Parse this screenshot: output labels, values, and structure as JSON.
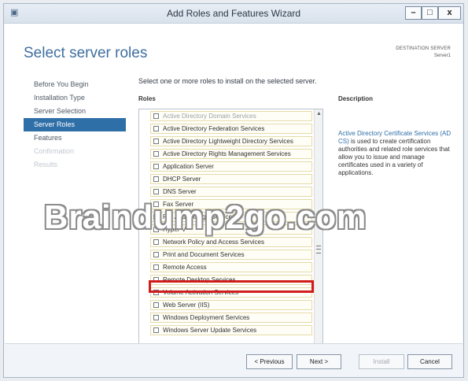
{
  "window": {
    "title": "Add Roles and Features Wizard",
    "controls": {
      "minimize": "–",
      "maximize": "□",
      "close": "x"
    }
  },
  "header": {
    "page_title": "Select server roles",
    "destination_label": "DESTINATION SERVER",
    "destination_value": "Server1"
  },
  "nav": {
    "items": [
      {
        "label": "Before You Begin",
        "state": "normal"
      },
      {
        "label": "Installation Type",
        "state": "normal"
      },
      {
        "label": "Server Selection",
        "state": "normal"
      },
      {
        "label": "Server Roles",
        "state": "active"
      },
      {
        "label": "Features",
        "state": "normal"
      },
      {
        "label": "Confirmation",
        "state": "disabled"
      },
      {
        "label": "Results",
        "state": "disabled"
      }
    ]
  },
  "main": {
    "instruction": "Select one or more roles to install on the selected server.",
    "roles_heading": "Roles",
    "roles": [
      "Active Directory Domain Services",
      "Active Directory Federation Services",
      "Active Directory Lightweight Directory Services",
      "Active Directory Rights Management Services",
      "Application Server",
      "DHCP Server",
      "DNS Server",
      "Fax Server",
      "File And Storage Services",
      "Hyper-V",
      "Network Policy and Access Services",
      "Print and Document Services",
      "Remote Access",
      "Remote Desktop Services",
      "Volume Activation Services",
      "Web Server (IIS)",
      "Windows Deployment Services",
      "Windows Server Update Services"
    ],
    "highlighted_role": "Remote Access"
  },
  "description": {
    "heading": "Description",
    "link_text": "Active Directory Certificate Services (AD CS)",
    "body": " is used to create certification authorities and related role services that allow you to issue and manage certificates used in a variety of applications."
  },
  "watermark": "Braindump2go.com",
  "footer": {
    "previous": "< Previous",
    "next": "Next >",
    "install": "Install",
    "cancel": "Cancel"
  },
  "colors": {
    "accent": "#2f6fa8",
    "title": "#3f6f9f",
    "highlight": "#d01c1c"
  }
}
